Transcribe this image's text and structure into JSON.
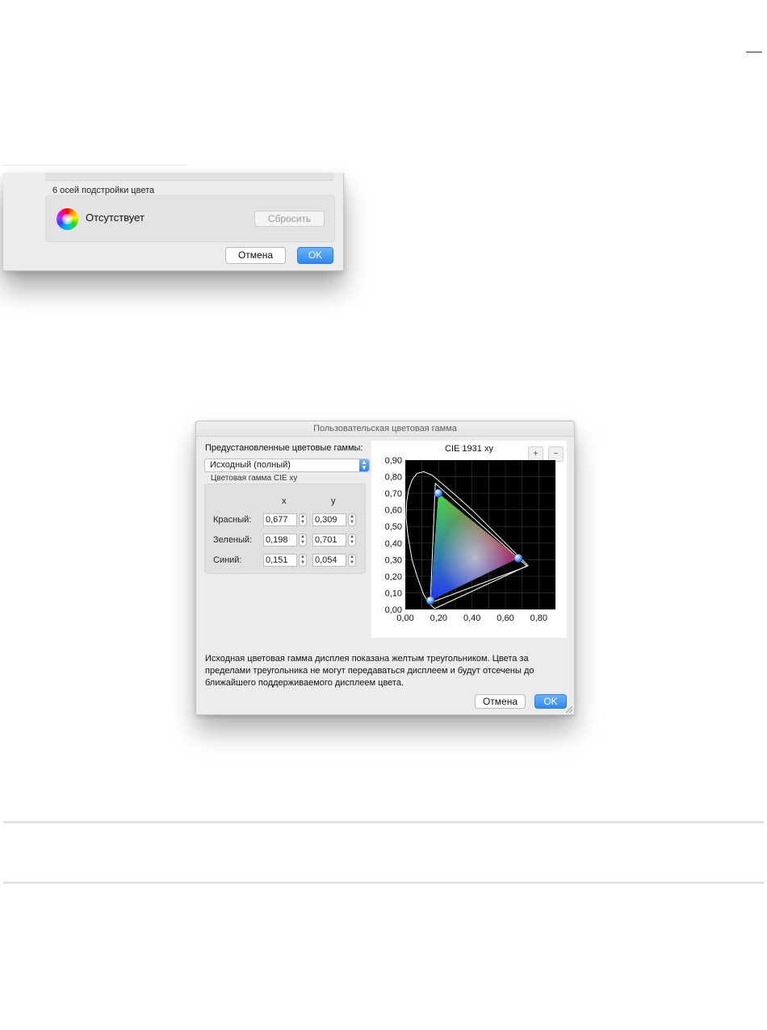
{
  "crop_dialog": {
    "axes_label": "6 осей подстройки цвета",
    "status_text": "Отсутствует",
    "reset_button": "Сбросить",
    "cancel_button": "Отмена",
    "ok_button": "OK"
  },
  "gamut_dialog": {
    "title": "Пользовательская цветовая гамма",
    "preset_label": "Предустановленные цветовые гаммы:",
    "preset_value": "Исходный (полный)",
    "cie_group_label": "Цветовая гамма CIE xy",
    "columns": {
      "x": "x",
      "y": "y"
    },
    "rows": [
      {
        "label": "Красный:",
        "x": "0,677",
        "y": "0,309"
      },
      {
        "label": "Зеленый:",
        "x": "0,198",
        "y": "0,701"
      },
      {
        "label": "Синий:",
        "x": "0,151",
        "y": "0,054"
      }
    ],
    "info_text": "Исходная цветовая гамма дисплея показана желтым треугольником. Цвета за пределами треугольника не могут передаваться дисплеем и будут отсечены до ближайшего поддерживаемого дисплеем цвета.",
    "cancel_button": "Отмена",
    "ok_button": "OK",
    "zoom_in_icon": "zoom-in-icon",
    "zoom_out_icon": "zoom-out-icon"
  },
  "chart_data": {
    "type": "scatter",
    "title": "CIE 1931 xy",
    "xlabel": "",
    "ylabel": "",
    "xlim": [
      0,
      0.9
    ],
    "ylim": [
      0,
      0.9
    ],
    "grid": true,
    "x_ticks": [
      "0,00",
      "0,20",
      "0,40",
      "0,60",
      "0,80"
    ],
    "y_ticks": [
      "0,00",
      "0,10",
      "0,20",
      "0,30",
      "0,40",
      "0,50",
      "0,60",
      "0,70",
      "0,80",
      "0,90"
    ],
    "series": [
      {
        "x": [
          0.677,
          0.198,
          0.151
        ],
        "y": [
          0.309,
          0.701,
          0.054
        ]
      }
    ],
    "reference_triangle": {
      "x": [
        0.73,
        0.18,
        0.15
      ],
      "y": [
        0.26,
        0.76,
        0.04
      ]
    }
  }
}
